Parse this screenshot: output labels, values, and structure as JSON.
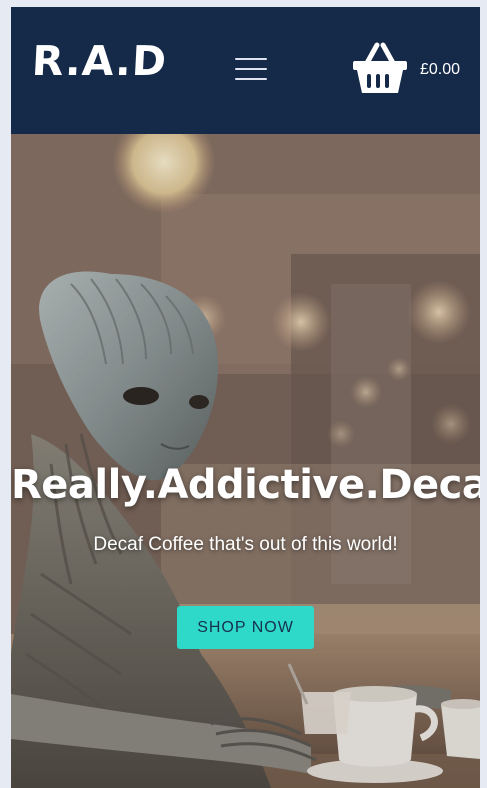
{
  "header": {
    "logo_text": "R.A.D",
    "menu_icon": "hamburger-menu-icon",
    "cart_icon": "basket-icon",
    "cart_total": "£0.00",
    "background_color": "#152a49"
  },
  "hero": {
    "title": "Really.Addictive.Decaf",
    "subtitle": "Decaf Coffee that's out of this world!",
    "cta_label": "SHOP NOW",
    "cta_color": "#2fd9c9"
  }
}
